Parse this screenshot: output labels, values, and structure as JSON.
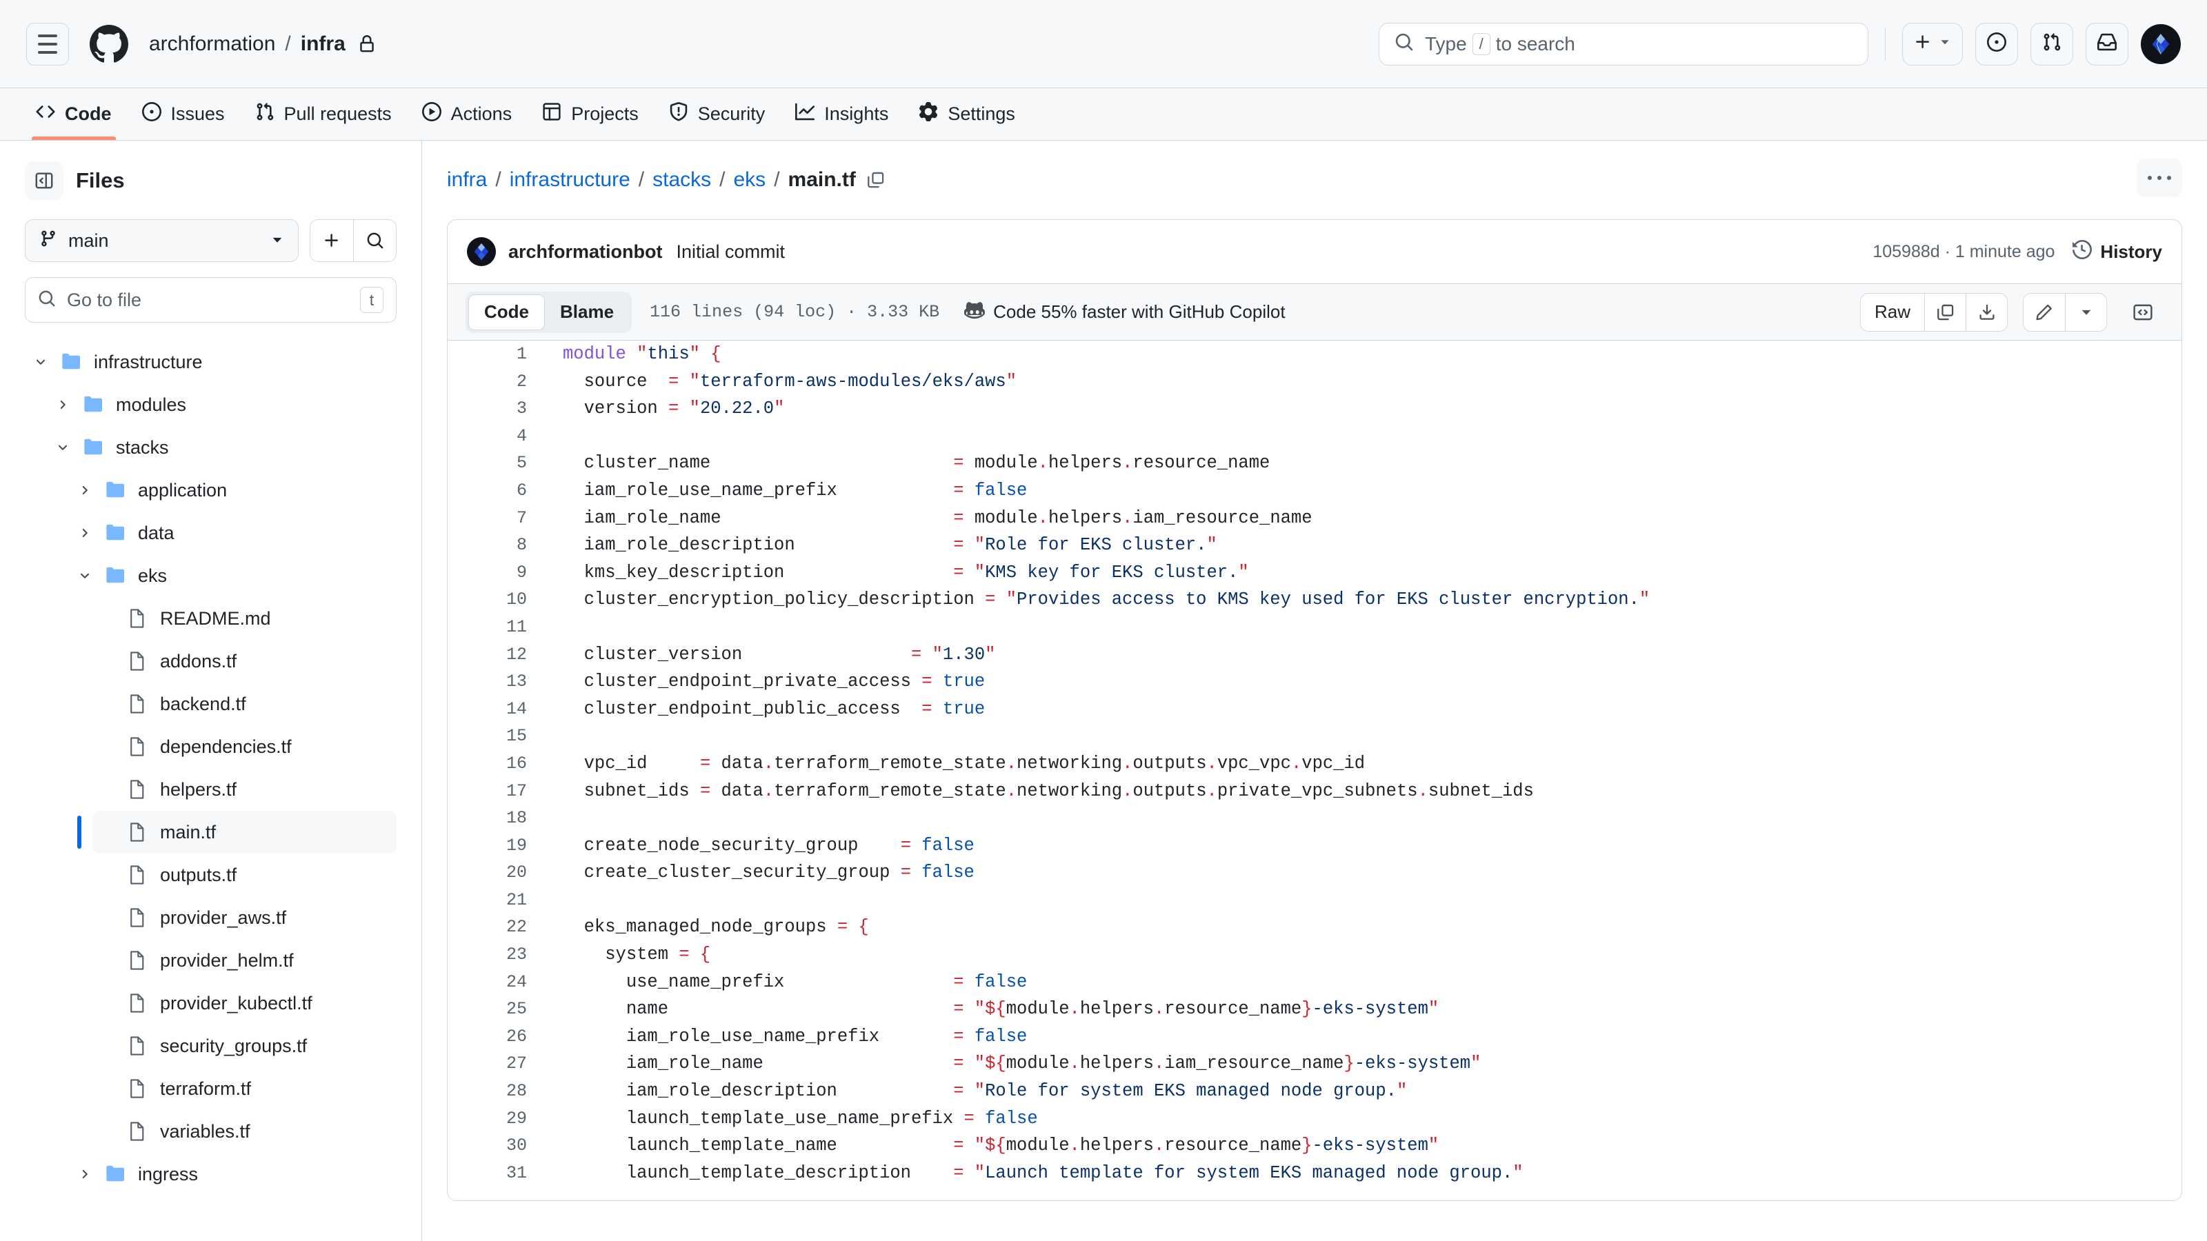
{
  "header": {
    "menu_icon": "hamburger-icon",
    "logo_icon": "github-logo-icon",
    "owner": "archformation",
    "separator": "/",
    "repo": "infra",
    "visibility_icon": "lock-icon",
    "search": {
      "placeholder_pre": "Type",
      "kbd": "/",
      "placeholder_post": "to search",
      "icon": "search-icon"
    },
    "create_button": "plus-icon",
    "create_caret": "chevron-down-icon",
    "issues_button": "issue-opened-icon",
    "pulls_button": "git-pull-request-icon",
    "inbox_button": "inbox-icon",
    "avatar": "user-avatar"
  },
  "repo_nav": {
    "items": [
      {
        "label": "Code",
        "icon": "code-icon",
        "active": true
      },
      {
        "label": "Issues",
        "icon": "issue-opened-icon",
        "active": false
      },
      {
        "label": "Pull requests",
        "icon": "git-pull-request-icon",
        "active": false
      },
      {
        "label": "Actions",
        "icon": "play-icon",
        "active": false
      },
      {
        "label": "Projects",
        "icon": "table-icon",
        "active": false
      },
      {
        "label": "Security",
        "icon": "shield-icon",
        "active": false
      },
      {
        "label": "Insights",
        "icon": "graph-icon",
        "active": false
      },
      {
        "label": "Settings",
        "icon": "gear-icon",
        "active": false
      }
    ]
  },
  "sidebar": {
    "collapse_icon": "sidebar-collapse-icon",
    "title": "Files",
    "branch": {
      "icon": "git-branch-icon",
      "value": "main",
      "caret": "chevron-down-icon"
    },
    "add_file_icon": "plus-icon",
    "search_files_icon": "search-icon",
    "go_to_file": {
      "icon": "search-icon",
      "placeholder": "Go to file",
      "kbd": "t"
    },
    "tree": [
      {
        "label": "infrastructure",
        "type": "folder",
        "depth": 0,
        "state": "open",
        "selected": false
      },
      {
        "label": "modules",
        "type": "folder",
        "depth": 1,
        "state": "closed",
        "selected": false
      },
      {
        "label": "stacks",
        "type": "folder",
        "depth": 1,
        "state": "open",
        "selected": false
      },
      {
        "label": "application",
        "type": "folder",
        "depth": 2,
        "state": "closed",
        "selected": false
      },
      {
        "label": "data",
        "type": "folder",
        "depth": 2,
        "state": "closed",
        "selected": false
      },
      {
        "label": "eks",
        "type": "folder",
        "depth": 2,
        "state": "open",
        "selected": false
      },
      {
        "label": "README.md",
        "type": "file",
        "depth": 3,
        "state": "none",
        "selected": false
      },
      {
        "label": "addons.tf",
        "type": "file",
        "depth": 3,
        "state": "none",
        "selected": false
      },
      {
        "label": "backend.tf",
        "type": "file",
        "depth": 3,
        "state": "none",
        "selected": false
      },
      {
        "label": "dependencies.tf",
        "type": "file",
        "depth": 3,
        "state": "none",
        "selected": false
      },
      {
        "label": "helpers.tf",
        "type": "file",
        "depth": 3,
        "state": "none",
        "selected": false
      },
      {
        "label": "main.tf",
        "type": "file",
        "depth": 3,
        "state": "none",
        "selected": true
      },
      {
        "label": "outputs.tf",
        "type": "file",
        "depth": 3,
        "state": "none",
        "selected": false
      },
      {
        "label": "provider_aws.tf",
        "type": "file",
        "depth": 3,
        "state": "none",
        "selected": false
      },
      {
        "label": "provider_helm.tf",
        "type": "file",
        "depth": 3,
        "state": "none",
        "selected": false
      },
      {
        "label": "provider_kubectl.tf",
        "type": "file",
        "depth": 3,
        "state": "none",
        "selected": false
      },
      {
        "label": "security_groups.tf",
        "type": "file",
        "depth": 3,
        "state": "none",
        "selected": false
      },
      {
        "label": "terraform.tf",
        "type": "file",
        "depth": 3,
        "state": "none",
        "selected": false
      },
      {
        "label": "variables.tf",
        "type": "file",
        "depth": 3,
        "state": "none",
        "selected": false
      },
      {
        "label": "ingress",
        "type": "folder",
        "depth": 2,
        "state": "closed",
        "selected": false
      }
    ]
  },
  "main": {
    "breadcrumb": [
      {
        "label": "infra",
        "link": true
      },
      {
        "label": "infrastructure",
        "link": true
      },
      {
        "label": "stacks",
        "link": true
      },
      {
        "label": "eks",
        "link": true
      },
      {
        "label": "main.tf",
        "link": false
      }
    ],
    "breadcrumb_separator": "/",
    "copy_path_icon": "copy-icon",
    "more_options_icon": "kebab-horizontal-icon",
    "commit": {
      "avatar": "bot-avatar",
      "author": "archformationbot",
      "message": "Initial commit",
      "hash_and_time": "105988d · 1 minute ago",
      "history_icon": "history-icon",
      "history_label": "History"
    },
    "file_toolbar": {
      "tabs": [
        {
          "label": "Code",
          "active": true
        },
        {
          "label": "Blame",
          "active": false
        }
      ],
      "file_meta": "116 lines (94 loc) · 3.33 KB",
      "copilot_icon": "copilot-icon",
      "copilot_text": "Code 55% faster with GitHub Copilot",
      "raw_label": "Raw",
      "copy_raw_icon": "copy-icon",
      "download_icon": "download-icon",
      "edit_icon": "pencil-icon",
      "edit_caret_icon": "chevron-down-icon",
      "symbols_icon": "code-square-icon"
    }
  },
  "code": {
    "language": "terraform",
    "colors": {
      "keyword": "#8250df",
      "string": "#0a3069",
      "punctuation": "#cf222e",
      "constant": "#0550ae",
      "plain": "#1f2328",
      "line_number": "#59636e"
    },
    "lines": [
      {
        "n": 1,
        "tokens": [
          [
            "k",
            "module"
          ],
          [
            "p",
            " "
          ],
          [
            "q",
            "\""
          ],
          [
            "s",
            "this"
          ],
          [
            "q",
            "\""
          ],
          [
            "p",
            " "
          ],
          [
            "q",
            "{"
          ]
        ]
      },
      {
        "n": 2,
        "tokens": [
          [
            "p",
            "  source  "
          ],
          [
            "q",
            "= \""
          ],
          [
            "s",
            "terraform-aws-modules/eks/aws"
          ],
          [
            "q",
            "\""
          ]
        ]
      },
      {
        "n": 3,
        "tokens": [
          [
            "p",
            "  version "
          ],
          [
            "q",
            "= \""
          ],
          [
            "s",
            "20.22.0"
          ],
          [
            "q",
            "\""
          ]
        ]
      },
      {
        "n": 4,
        "tokens": []
      },
      {
        "n": 5,
        "tokens": [
          [
            "p",
            "  cluster_name                       "
          ],
          [
            "q",
            "= "
          ],
          [
            "p",
            "module"
          ],
          [
            "q",
            "."
          ],
          [
            "p",
            "helpers"
          ],
          [
            "q",
            "."
          ],
          [
            "p",
            "resource_name"
          ]
        ]
      },
      {
        "n": 6,
        "tokens": [
          [
            "p",
            "  iam_role_use_name_prefix           "
          ],
          [
            "q",
            "= "
          ],
          [
            "b",
            "false"
          ]
        ]
      },
      {
        "n": 7,
        "tokens": [
          [
            "p",
            "  iam_role_name                      "
          ],
          [
            "q",
            "= "
          ],
          [
            "p",
            "module"
          ],
          [
            "q",
            "."
          ],
          [
            "p",
            "helpers"
          ],
          [
            "q",
            "."
          ],
          [
            "p",
            "iam_resource_name"
          ]
        ]
      },
      {
        "n": 8,
        "tokens": [
          [
            "p",
            "  iam_role_description               "
          ],
          [
            "q",
            "= \""
          ],
          [
            "s",
            "Role for EKS cluster."
          ],
          [
            "q",
            "\""
          ]
        ]
      },
      {
        "n": 9,
        "tokens": [
          [
            "p",
            "  kms_key_description                "
          ],
          [
            "q",
            "= \""
          ],
          [
            "s",
            "KMS key for EKS cluster."
          ],
          [
            "q",
            "\""
          ]
        ]
      },
      {
        "n": 10,
        "tokens": [
          [
            "p",
            "  cluster_encryption_policy_description "
          ],
          [
            "q",
            "= \""
          ],
          [
            "s",
            "Provides access to KMS key used for EKS cluster encryption."
          ],
          [
            "q",
            "\""
          ]
        ]
      },
      {
        "n": 11,
        "tokens": []
      },
      {
        "n": 12,
        "tokens": [
          [
            "p",
            "  cluster_version                "
          ],
          [
            "q",
            "= \""
          ],
          [
            "s",
            "1.30"
          ],
          [
            "q",
            "\""
          ]
        ]
      },
      {
        "n": 13,
        "tokens": [
          [
            "p",
            "  cluster_endpoint_private_access "
          ],
          [
            "q",
            "= "
          ],
          [
            "b",
            "true"
          ]
        ]
      },
      {
        "n": 14,
        "tokens": [
          [
            "p",
            "  cluster_endpoint_public_access  "
          ],
          [
            "q",
            "= "
          ],
          [
            "b",
            "true"
          ]
        ]
      },
      {
        "n": 15,
        "tokens": []
      },
      {
        "n": 16,
        "tokens": [
          [
            "p",
            "  vpc_id     "
          ],
          [
            "q",
            "= "
          ],
          [
            "p",
            "data"
          ],
          [
            "q",
            "."
          ],
          [
            "p",
            "terraform_remote_state"
          ],
          [
            "q",
            "."
          ],
          [
            "p",
            "networking"
          ],
          [
            "q",
            "."
          ],
          [
            "p",
            "outputs"
          ],
          [
            "q",
            "."
          ],
          [
            "p",
            "vpc_vpc"
          ],
          [
            "q",
            "."
          ],
          [
            "p",
            "vpc_id"
          ]
        ]
      },
      {
        "n": 17,
        "tokens": [
          [
            "p",
            "  subnet_ids "
          ],
          [
            "q",
            "= "
          ],
          [
            "p",
            "data"
          ],
          [
            "q",
            "."
          ],
          [
            "p",
            "terraform_remote_state"
          ],
          [
            "q",
            "."
          ],
          [
            "p",
            "networking"
          ],
          [
            "q",
            "."
          ],
          [
            "p",
            "outputs"
          ],
          [
            "q",
            "."
          ],
          [
            "p",
            "private_vpc_subnets"
          ],
          [
            "q",
            "."
          ],
          [
            "p",
            "subnet_ids"
          ]
        ]
      },
      {
        "n": 18,
        "tokens": []
      },
      {
        "n": 19,
        "tokens": [
          [
            "p",
            "  create_node_security_group    "
          ],
          [
            "q",
            "= "
          ],
          [
            "b",
            "false"
          ]
        ]
      },
      {
        "n": 20,
        "tokens": [
          [
            "p",
            "  create_cluster_security_group "
          ],
          [
            "q",
            "= "
          ],
          [
            "b",
            "false"
          ]
        ]
      },
      {
        "n": 21,
        "tokens": []
      },
      {
        "n": 22,
        "tokens": [
          [
            "p",
            "  eks_managed_node_groups "
          ],
          [
            "q",
            "= {"
          ]
        ]
      },
      {
        "n": 23,
        "tokens": [
          [
            "p",
            "    system "
          ],
          [
            "q",
            "= {"
          ]
        ]
      },
      {
        "n": 24,
        "tokens": [
          [
            "p",
            "      use_name_prefix                "
          ],
          [
            "q",
            "= "
          ],
          [
            "b",
            "false"
          ]
        ]
      },
      {
        "n": 25,
        "tokens": [
          [
            "p",
            "      name                           "
          ],
          [
            "q",
            "= \"${"
          ],
          [
            "p",
            "module"
          ],
          [
            "q",
            "."
          ],
          [
            "p",
            "helpers"
          ],
          [
            "q",
            "."
          ],
          [
            "p",
            "resource_name"
          ],
          [
            "q",
            "}"
          ],
          [
            "s",
            "-eks-system"
          ],
          [
            "q",
            "\""
          ]
        ]
      },
      {
        "n": 26,
        "tokens": [
          [
            "p",
            "      iam_role_use_name_prefix       "
          ],
          [
            "q",
            "= "
          ],
          [
            "b",
            "false"
          ]
        ]
      },
      {
        "n": 27,
        "tokens": [
          [
            "p",
            "      iam_role_name                  "
          ],
          [
            "q",
            "= \"${"
          ],
          [
            "p",
            "module"
          ],
          [
            "q",
            "."
          ],
          [
            "p",
            "helpers"
          ],
          [
            "q",
            "."
          ],
          [
            "p",
            "iam_resource_name"
          ],
          [
            "q",
            "}"
          ],
          [
            "s",
            "-eks-system"
          ],
          [
            "q",
            "\""
          ]
        ]
      },
      {
        "n": 28,
        "tokens": [
          [
            "p",
            "      iam_role_description           "
          ],
          [
            "q",
            "= \""
          ],
          [
            "s",
            "Role for system EKS managed node group."
          ],
          [
            "q",
            "\""
          ]
        ]
      },
      {
        "n": 29,
        "tokens": [
          [
            "p",
            "      launch_template_use_name_prefix "
          ],
          [
            "q",
            "= "
          ],
          [
            "b",
            "false"
          ]
        ]
      },
      {
        "n": 30,
        "tokens": [
          [
            "p",
            "      launch_template_name           "
          ],
          [
            "q",
            "= \"${"
          ],
          [
            "p",
            "module"
          ],
          [
            "q",
            "."
          ],
          [
            "p",
            "helpers"
          ],
          [
            "q",
            "."
          ],
          [
            "p",
            "resource_name"
          ],
          [
            "q",
            "}"
          ],
          [
            "s",
            "-eks-system"
          ],
          [
            "q",
            "\""
          ]
        ]
      },
      {
        "n": 31,
        "tokens": [
          [
            "p",
            "      launch_template_description    "
          ],
          [
            "q",
            "= \""
          ],
          [
            "s",
            "Launch template for system EKS managed node group."
          ],
          [
            "q",
            "\""
          ]
        ]
      }
    ]
  }
}
